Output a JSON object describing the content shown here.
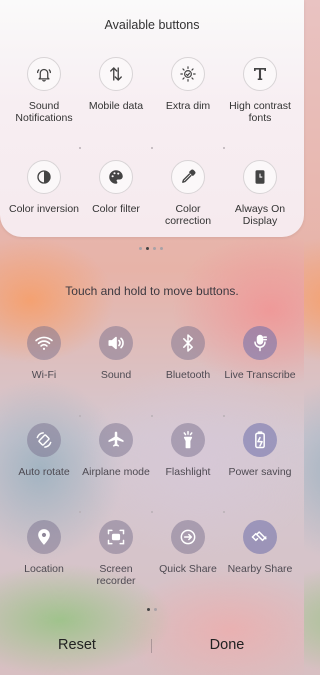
{
  "available": {
    "title": "Available buttons",
    "buttons": [
      {
        "label": "Sound Notifications",
        "icon": "sound-notifications-icon"
      },
      {
        "label": "Mobile data",
        "icon": "mobile-data-icon"
      },
      {
        "label": "Extra dim",
        "icon": "extra-dim-icon"
      },
      {
        "label": "High contrast fonts",
        "icon": "high-contrast-fonts-icon"
      },
      {
        "label": "Color inversion",
        "icon": "color-inversion-icon"
      },
      {
        "label": "Color filter",
        "icon": "color-filter-icon"
      },
      {
        "label": "Color correction",
        "icon": "color-correction-icon"
      },
      {
        "label": "Always On Display",
        "icon": "always-on-display-icon"
      }
    ],
    "page_count": 4,
    "active_page": 1
  },
  "hint": "Touch and hold to move buttons.",
  "active": {
    "buttons": [
      {
        "label": "Wi-Fi",
        "icon": "wifi-icon"
      },
      {
        "label": "Sound",
        "icon": "sound-icon"
      },
      {
        "label": "Bluetooth",
        "icon": "bluetooth-icon"
      },
      {
        "label": "Live Transcribe",
        "icon": "live-transcribe-icon"
      },
      {
        "label": "Auto rotate",
        "icon": "auto-rotate-icon"
      },
      {
        "label": "Airplane mode",
        "icon": "airplane-icon"
      },
      {
        "label": "Flashlight",
        "icon": "flashlight-icon"
      },
      {
        "label": "Power saving",
        "icon": "power-saving-icon"
      },
      {
        "label": "Location",
        "icon": "location-icon"
      },
      {
        "label": "Screen recorder",
        "icon": "screen-recorder-icon"
      },
      {
        "label": "Quick Share",
        "icon": "quick-share-icon"
      },
      {
        "label": "Nearby Share",
        "icon": "nearby-share-icon"
      }
    ],
    "page_count": 2,
    "active_page": 0
  },
  "footer": {
    "reset_label": "Reset",
    "done_label": "Done"
  }
}
